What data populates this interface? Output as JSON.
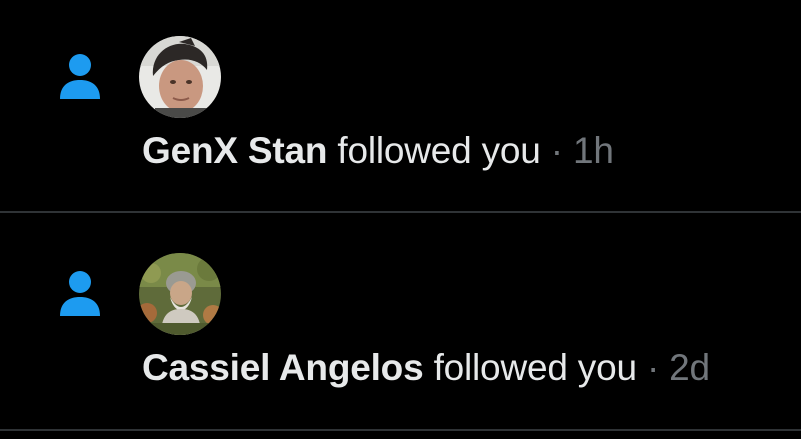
{
  "notifications": [
    {
      "name": "GenX Stan",
      "action": "followed you",
      "separator": "·",
      "time": "1h",
      "icon": "person-icon",
      "avatar": "avatar"
    },
    {
      "name": "Cassiel Angelos",
      "action": "followed you",
      "separator": "·",
      "time": "2d",
      "icon": "person-icon",
      "avatar": "avatar"
    }
  ],
  "colors": {
    "background": "#000000",
    "accent": "#1d9bf0",
    "text": "#e7e9ea",
    "muted": "#71767b",
    "divider": "#2f3336"
  }
}
